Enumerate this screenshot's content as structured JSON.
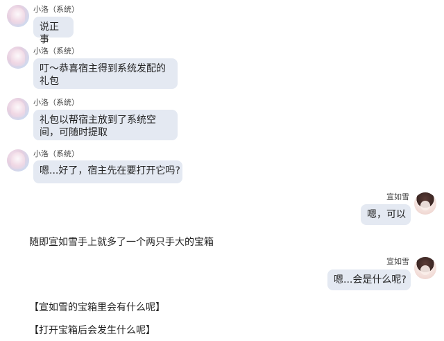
{
  "system_name": "小洛（系统）",
  "user_name": "宣如雪",
  "messages": [
    {
      "speaker": "system",
      "text": "说正事"
    },
    {
      "speaker": "system",
      "text": "叮～恭喜宿主得到系统发配的礼包"
    },
    {
      "speaker": "system",
      "text": "礼包以帮宿主放到了系统空间，可随时提取"
    },
    {
      "speaker": "system",
      "text": "嗯...好了，宿主先在要打开它吗?"
    },
    {
      "speaker": "user",
      "text": "嗯，可以"
    },
    {
      "speaker": "user",
      "text": "嗯...会是什么呢?"
    }
  ],
  "narration": [
    "随即宣如雪手上就多了一个两只手大的宝箱",
    "【宣如雪的宝箱里会有什么呢】",
    "【打开宝箱后会发生什么呢】"
  ],
  "colors": {
    "bubble": "#e4e9f2",
    "background": "#ffffff"
  },
  "icons": {
    "system_avatar": "system-avatar-icon",
    "user_avatar": "user-avatar-icon"
  }
}
